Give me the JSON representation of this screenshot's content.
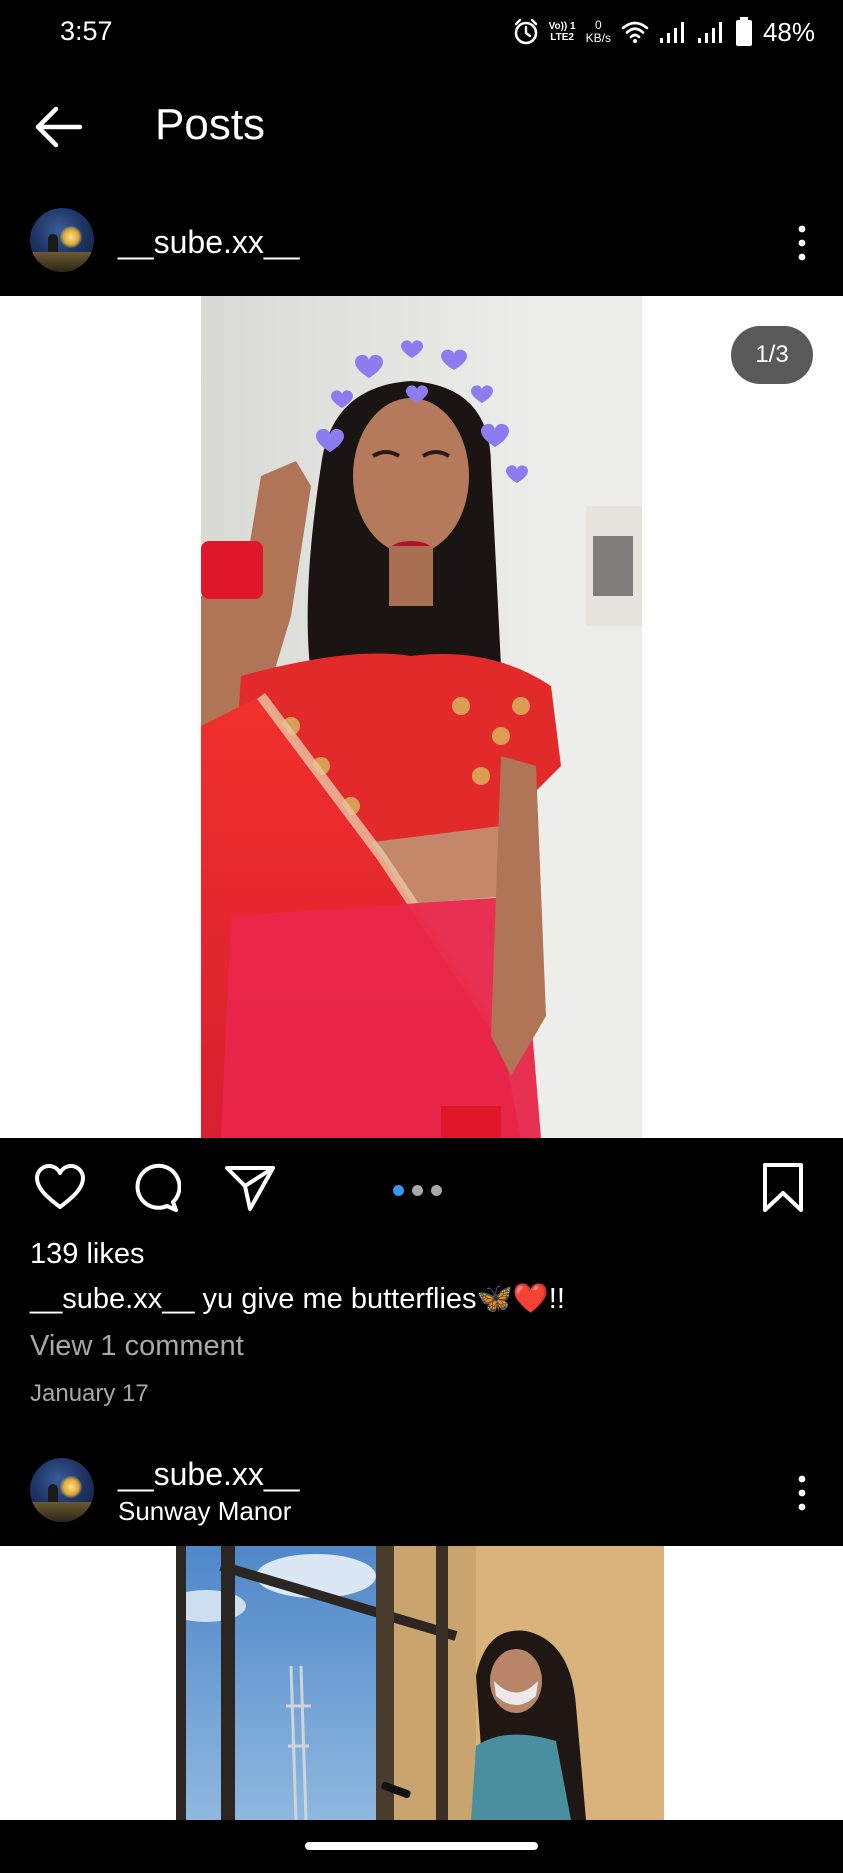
{
  "status_bar": {
    "time": "3:57",
    "volte_top": "Vo)) 1",
    "volte_bottom": "LTE2",
    "speed_value": "0",
    "speed_unit": "KB/s",
    "battery": "48%",
    "icons": [
      "alarm-icon",
      "wifi-icon",
      "signal-icon",
      "battery-icon"
    ]
  },
  "header": {
    "title": "Posts",
    "back_icon": "arrow-left-icon"
  },
  "posts": [
    {
      "username": "__sube.xx__",
      "location": "",
      "media_counter": "1/3",
      "carousel": {
        "count": 3,
        "active": 0
      },
      "likes": "139 likes",
      "caption_user": "__sube.xx__",
      "caption_text": "yu give me butterflies🦋❤️!!",
      "view_comments": "View 1 comment",
      "date": "January 17"
    },
    {
      "username": "__sube.xx__",
      "location": "Sunway Manor"
    }
  ],
  "colors": {
    "background": "#000000",
    "text": "#ffffff",
    "muted_text": "#a8a8a8",
    "accent_dot": "#3897f0",
    "media_background": "#ffffff"
  }
}
